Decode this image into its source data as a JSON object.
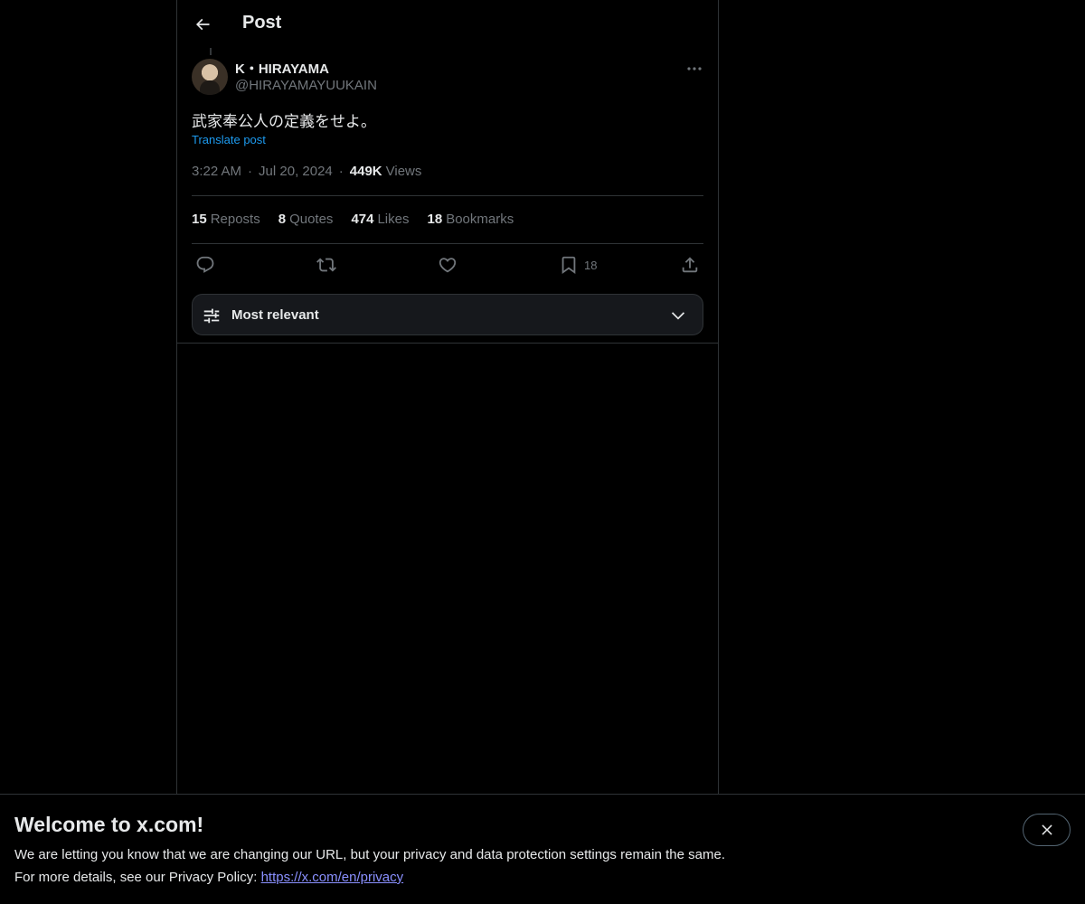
{
  "header": {
    "title": "Post"
  },
  "post": {
    "display_name": "K・HIRAYAMA",
    "handle": "@HIRAYAMAYUUKAIN",
    "text": "武家奉公人の定義をせよ。",
    "translate_label": "Translate post",
    "time": "3:22 AM",
    "date": "Jul 20, 2024",
    "views_count": "449K",
    "views_label": "Views"
  },
  "stats": {
    "reposts_count": "15",
    "reposts_label": "Reposts",
    "quotes_count": "8",
    "quotes_label": "Quotes",
    "likes_count": "474",
    "likes_label": "Likes",
    "bookmarks_count": "18",
    "bookmarks_label": "Bookmarks"
  },
  "actions": {
    "bookmark_count": "18"
  },
  "sort": {
    "label": "Most relevant"
  },
  "banner": {
    "title": "Welcome to x.com!",
    "line1": "We are letting you know that we are changing our URL, but your privacy and data protection settings remain the same.",
    "line2_prefix": "For more details, see our Privacy Policy: ",
    "link": "https://x.com/en/privacy"
  },
  "colors": {
    "accent": "#1d9bf0",
    "muted": "#71767b",
    "text": "#e7e9ea",
    "border": "#2f3336",
    "link_banner": "#8a90ff"
  }
}
